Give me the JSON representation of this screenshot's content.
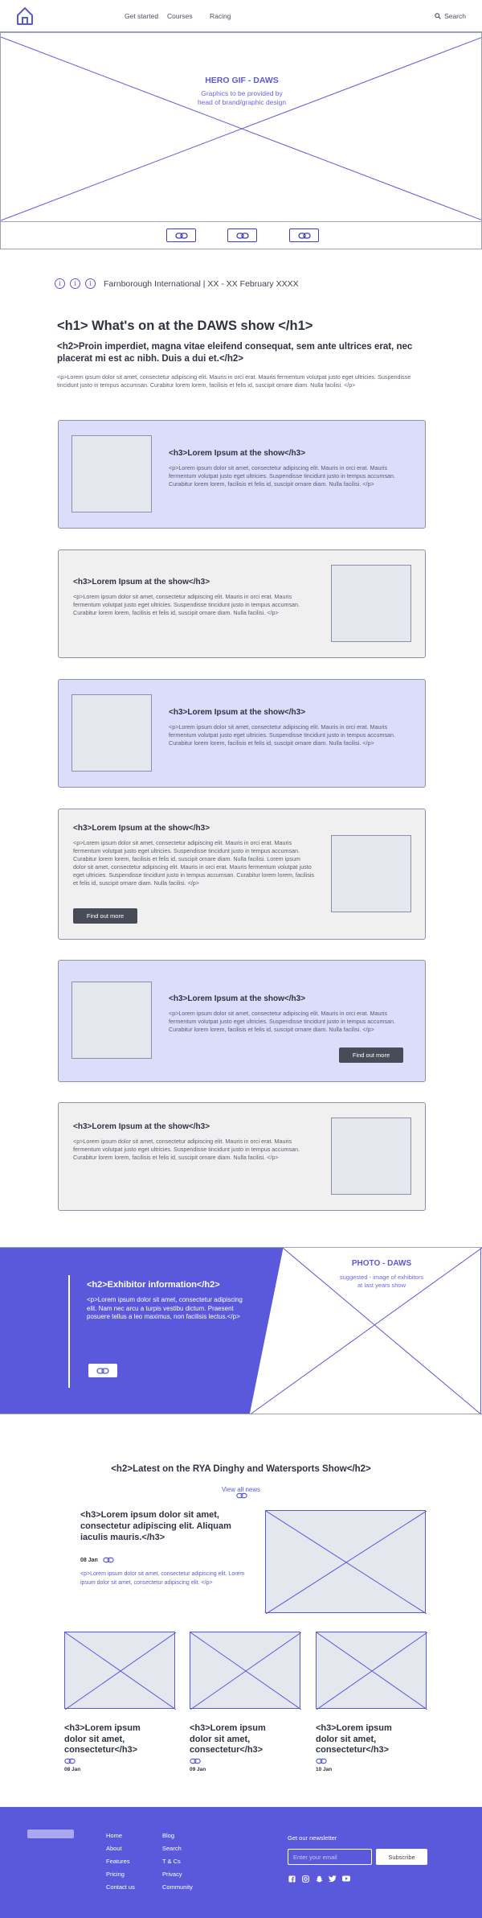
{
  "nav": {
    "links": [
      "Get started",
      "Courses",
      "Racing"
    ],
    "search_label": "Search"
  },
  "hero": {
    "title": "HERO GIF - DAWS",
    "subtitle": "Graphics to be provided by head of brand/graphic design"
  },
  "info_bar": {
    "text": "Farnborough International | XX - XX  February XXXX"
  },
  "intro": {
    "h1": "<h1> What's on at the DAWS show </h1>",
    "h2": "<h2>Proin imperdiet, magna vitae eleifend consequat, sem ante ultrices erat, nec placerat mi est ac nibh. Duis a dui et.</h2>",
    "p": "<p>Lorem ipsum dolor sit amet, consectetur adipiscing elit. Mauris in orci erat. Mauris fermentum volutpat justo eget ultricies. Suspendisse tincidunt justo in tempus accumsan. Curabitur lorem lorem, facilisis et felis id, suscipit ornare diam. Nulla facilisi. </p>"
  },
  "cards": [
    {
      "title": "<h3>Lorem Ipsum at the show</h3>",
      "text": "<p>Lorem ipsum dolor sit amet, consectetur adipiscing elit. Mauris in orci erat. Mauris fermentum volutpat justo eget ultricies. Suspendisse tincidunt justo in tempus accumsan. Curabitur lorem lorem, facilisis et felis id, suscipit ornare diam. Nulla facilisi. </p>"
    },
    {
      "title": "<h3>Lorem Ipsum at the show</h3>",
      "text": "<p>Lorem ipsum dolor sit amet, consectetur adipiscing elit. Mauris in orci erat. Mauris fermentum volutpat justo eget ultricies. Suspendisse tincidunt justo in tempus accumsan. Curabitur lorem lorem, facilisis et felis id, suscipit ornare diam. Nulla facilisi. </p>"
    },
    {
      "title": "<h3>Lorem Ipsum at the show</h3>",
      "text": "<p>Lorem ipsum dolor sit amet, consectetur adipiscing elit. Mauris in orci erat. Mauris fermentum volutpat justo eget ultricies. Suspendisse tincidunt justo in tempus accumsan. Curabitur lorem lorem, facilisis et felis id, suscipit ornare diam. Nulla facilisi. </p>"
    },
    {
      "title": "<h3>Lorem Ipsum at the show</h3>",
      "text": "<p>Lorem ipsum dolor sit amet, consectetur adipiscing elit. Mauris in orci erat. Mauris fermentum volutpat justo eget ultricies. Suspendisse tincidunt justo in tempus accumsan. Curabitur lorem lorem, facilisis et felis id, suscipit ornare diam. Nulla facilisi. Lorem ipsum dolor sit amet, consectetur adipiscing elit. Mauris in orci erat. Mauris fermentum volutpat justo eget ultricies. Suspendisse tincidunt justo in tempus accumsan. Curabitur lorem lorem, facilisis et felis id, suscipit ornare diam. Nulla facilisi.  </p>",
      "button": "Find out more"
    },
    {
      "title": "<h3>Lorem Ipsum at the show</h3>",
      "text": "<p>Lorem ipsum dolor sit amet, consectetur adipiscing elit. Mauris in orci erat. Mauris fermentum volutpat justo eget ultricies. Suspendisse tincidunt justo in tempus accumsan. Curabitur lorem lorem, facilisis et felis id, suscipit ornare diam. Nulla facilisi. </p>",
      "button": "Find out more"
    },
    {
      "title": "<h3>Lorem Ipsum at the show</h3>",
      "text": "<p>Lorem ipsum dolor sit amet, consectetur adipiscing elit. Mauris in orci erat. Mauris fermentum volutpat justo eget ultricies. Suspendisse tincidunt justo in tempus accumsan. Curabitur lorem lorem, facilisis et felis id, suscipit ornare diam. Nulla facilisi. </p>"
    }
  ],
  "exhibitor": {
    "h2": "<h2>Exhibitor information</h2>",
    "p": "<p>Lorem ipsum dolor sit amet, consectetur adipiscing elit. Nam nec arcu a turpis vestibu dictum. Praesent posuere tellus a leo maximus, non facilisis lectus.</p>",
    "photo_title": "PHOTO - DAWS",
    "photo_sub": "suggested - image of exhibitors at last years show"
  },
  "news": {
    "h2": "<h2>Latest on the RYA Dinghy and Watersports Show</h2>",
    "view_all": "View all news",
    "featured": {
      "title": "<h3>Lorem ipsum dolor sit amet, consectetur adipiscing elit. Aliquam iaculis mauris.</h3>",
      "date": "08 Jan",
      "p": "<p>Lorem ipsum dolor sit amet, consectetur adipiscing elit. Lorem ipsum dolor sit amet, consectetur adipiscing elit. </p>"
    },
    "items": [
      {
        "title": "<h3>Lorem ipsum dolor sit amet, consectetur</h3>",
        "date": "08 Jan"
      },
      {
        "title": "<h3>Lorem ipsum dolor sit amet, consectetur</h3>",
        "date": "09 Jan"
      },
      {
        "title": "<h3>Lorem ipsum dolor sit amet, consectetur</h3>",
        "date": "10 Jan"
      }
    ]
  },
  "footer": {
    "col1": [
      "Home",
      "About",
      "Features",
      "Pricing",
      "Contact us"
    ],
    "col2": [
      "Blog",
      "Search",
      "T & Cs",
      "Privacy",
      "Community"
    ],
    "newsletter_title": "Get our newsletter",
    "email_placeholder": "Enter your email",
    "subscribe_label": "Subscribe",
    "social_icons": [
      "facebook-icon",
      "instagram-icon",
      "snapchat-icon",
      "twitter-icon",
      "youtube-icon"
    ]
  },
  "colors": {
    "accent": "#5b59db",
    "card_purple": "#dcdcfb",
    "card_grey": "#f0f0f0",
    "button_dark": "#474c57"
  }
}
